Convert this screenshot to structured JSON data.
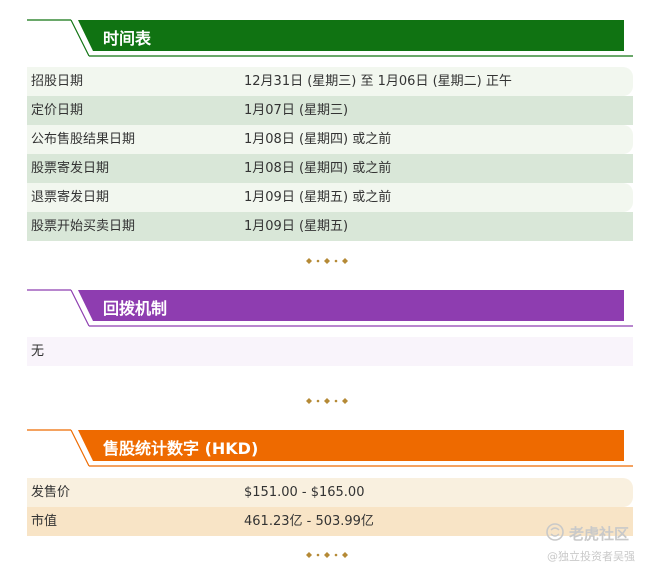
{
  "sections": {
    "timetable": {
      "title": "时间表",
      "color": "#107312",
      "rows": [
        {
          "label": "招股日期",
          "value": "12月31日 (星期三) 至 1月06日 (星期二) 正午"
        },
        {
          "label": "定价日期",
          "value": "1月07日 (星期三)"
        },
        {
          "label": "公布售股结果日期",
          "value": "1月08日 (星期四) 或之前"
        },
        {
          "label": "股票寄发日期",
          "value": "1月08日 (星期四) 或之前"
        },
        {
          "label": "退票寄发日期",
          "value": "1月09日 (星期五) 或之前"
        },
        {
          "label": "股票开始买卖日期",
          "value": "1月09日 (星期五)"
        }
      ]
    },
    "clawback": {
      "title": "回拨机制",
      "color": "#8e3db0",
      "rows": [
        {
          "label": "无"
        }
      ]
    },
    "statistics": {
      "title": "售股统计数字 (HKD)",
      "color": "#ee6a00",
      "rows": [
        {
          "label": "发售价",
          "value": "$151.00 - $165.00"
        },
        {
          "label": "市值",
          "value": "461.23亿 - 503.99亿"
        }
      ]
    }
  },
  "divider_color": "#b58a36",
  "watermark": {
    "name": "老虎社区",
    "sub": "@独立投资者吴强"
  }
}
